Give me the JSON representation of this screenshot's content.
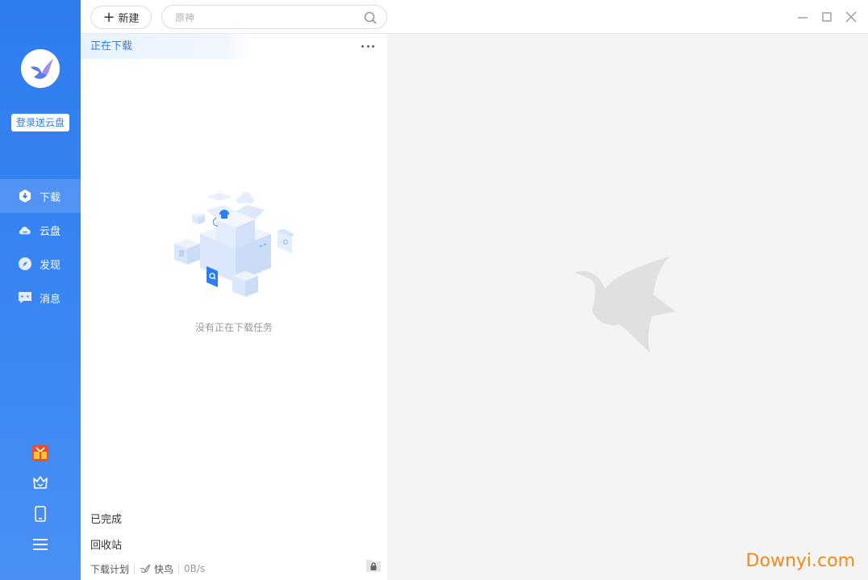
{
  "sidebar": {
    "login_label": "登录送云盘",
    "items": [
      {
        "label": "下载",
        "icon": "download-icon",
        "active": true
      },
      {
        "label": "云盘",
        "icon": "cloud-icon",
        "active": false
      },
      {
        "label": "发现",
        "icon": "compass-icon",
        "active": false
      },
      {
        "label": "消息",
        "icon": "message-icon",
        "active": false
      }
    ],
    "bottom_icons": [
      "gift-icon",
      "crown-icon",
      "phone-icon",
      "menu-icon"
    ]
  },
  "toolbar": {
    "new_label": "新建",
    "search_placeholder": "原神"
  },
  "list": {
    "active_tab": "正在下载",
    "empty_text": "没有正在下载任务",
    "completed_label": "已完成",
    "trash_label": "回收站"
  },
  "status": {
    "plan_label": "下载计划",
    "mode_label": "快鸟",
    "speed": "0B/s"
  },
  "watermark": {
    "brand": "Downyi.com"
  },
  "colors": {
    "accent": "#2f7cf0",
    "brand_orange": "#f08a1c",
    "detail_bg": "#f4f4f4"
  }
}
